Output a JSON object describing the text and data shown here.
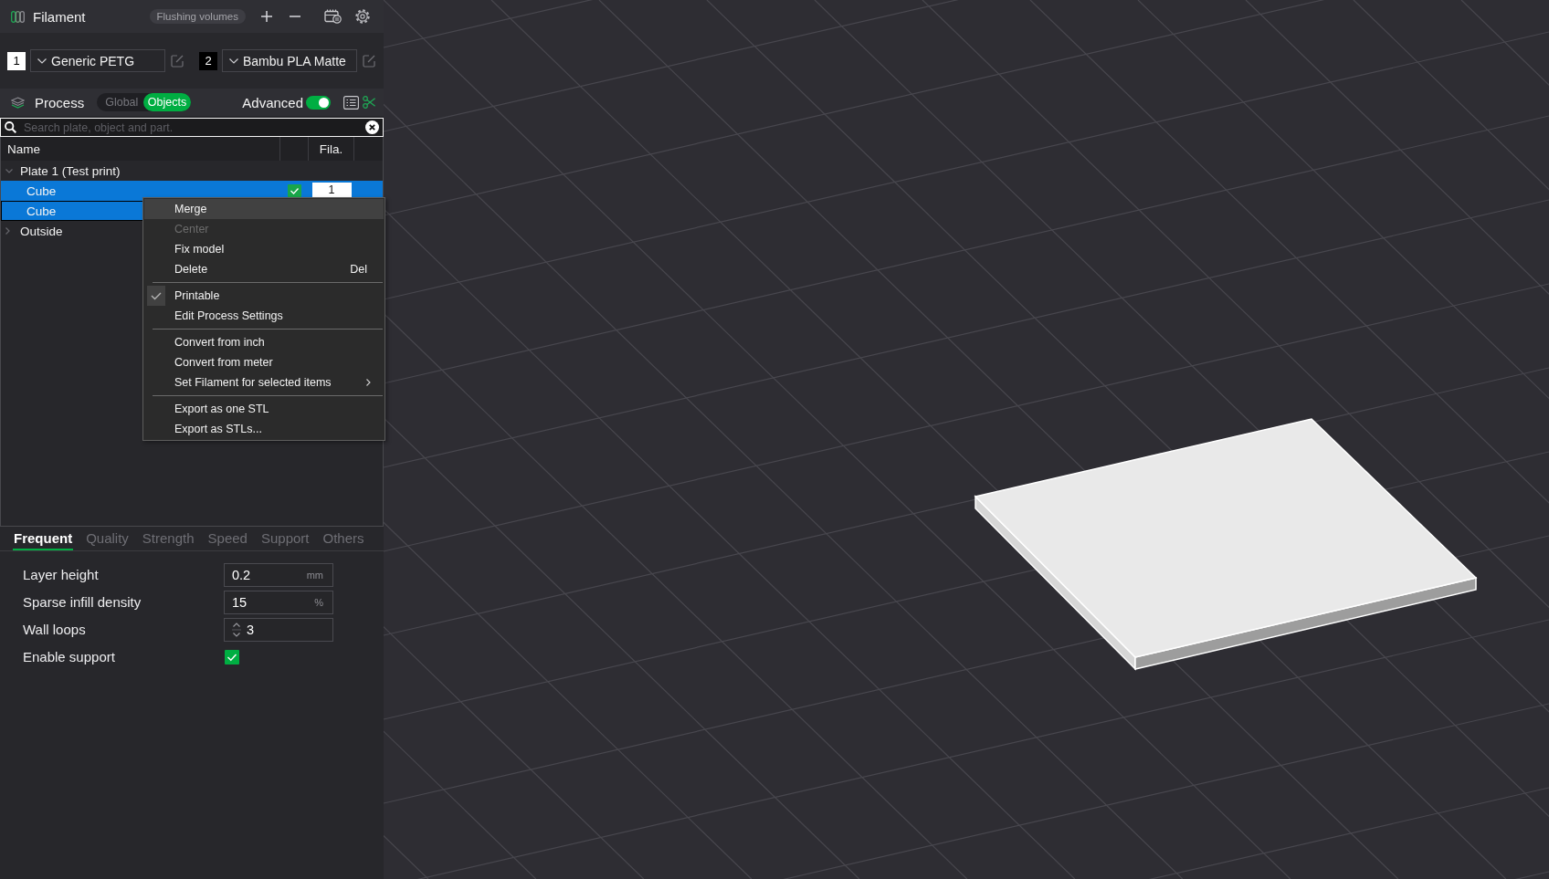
{
  "filament": {
    "title": "Filament",
    "flushing_button": "Flushing volumes",
    "slots": [
      {
        "number": "1",
        "color": "#ffffff",
        "material": "Generic PETG"
      },
      {
        "number": "2",
        "color": "#000000",
        "material": "Bambu PLA Matte"
      }
    ]
  },
  "process": {
    "title": "Process",
    "modes": [
      {
        "label": "Global",
        "selected": false
      },
      {
        "label": "Objects",
        "selected": true
      }
    ],
    "advanced": {
      "label": "Advanced",
      "on": true
    }
  },
  "search": {
    "placeholder": "Search plate, object and part."
  },
  "object_list": {
    "columns": {
      "name": "Name",
      "filament": "Fila."
    },
    "rows": [
      {
        "label": "Plate 1 (Test print)",
        "selected": false,
        "focused": false,
        "expanded": true,
        "children": [
          {
            "label": "Cube",
            "selected": true,
            "focused": false,
            "printable": true,
            "filament": "1"
          },
          {
            "label": "Cube",
            "selected": true,
            "focused": true
          }
        ]
      },
      {
        "label": "Outside",
        "selected": false,
        "focused": false,
        "expanded": false
      }
    ]
  },
  "context_menu": [
    {
      "kind": "item",
      "label": "Merge",
      "highlighted": true,
      "disabled": false,
      "checked": false,
      "submenu": false
    },
    {
      "kind": "item",
      "label": "Center",
      "highlighted": false,
      "disabled": true,
      "checked": false,
      "submenu": false
    },
    {
      "kind": "item",
      "label": "Fix model",
      "highlighted": false,
      "disabled": false,
      "checked": false,
      "submenu": false
    },
    {
      "kind": "item",
      "label": "Delete",
      "shortcut": "Del",
      "highlighted": false,
      "disabled": false,
      "checked": false,
      "submenu": false
    },
    {
      "kind": "separator"
    },
    {
      "kind": "item",
      "label": "Printable",
      "highlighted": false,
      "disabled": false,
      "checked": true,
      "submenu": false
    },
    {
      "kind": "item",
      "label": "Edit Process Settings",
      "highlighted": false,
      "disabled": false,
      "checked": false,
      "submenu": false
    },
    {
      "kind": "separator"
    },
    {
      "kind": "item",
      "label": "Convert from inch",
      "highlighted": false,
      "disabled": false,
      "checked": false,
      "submenu": false
    },
    {
      "kind": "item",
      "label": "Convert from meter",
      "highlighted": false,
      "disabled": false,
      "checked": false,
      "submenu": false
    },
    {
      "kind": "item",
      "label": "Set Filament for selected items",
      "highlighted": false,
      "disabled": false,
      "checked": false,
      "submenu": true
    },
    {
      "kind": "separator"
    },
    {
      "kind": "item",
      "label": "Export as one STL",
      "highlighted": false,
      "disabled": false,
      "checked": false,
      "submenu": false
    },
    {
      "kind": "item",
      "label": "Export as STLs...",
      "highlighted": false,
      "disabled": false,
      "checked": false,
      "submenu": false
    }
  ],
  "settings_tabs": [
    {
      "label": "Frequent",
      "selected": true
    },
    {
      "label": "Quality",
      "selected": false
    },
    {
      "label": "Strength",
      "selected": false
    },
    {
      "label": "Speed",
      "selected": false
    },
    {
      "label": "Support",
      "selected": false
    },
    {
      "label": "Others",
      "selected": false
    }
  ],
  "settings": [
    {
      "kind": "number",
      "label": "Layer height",
      "value": "0.2",
      "unit": "mm"
    },
    {
      "kind": "number",
      "label": "Sparse infill density",
      "value": "15",
      "unit": "%"
    },
    {
      "kind": "spin",
      "label": "Wall loops",
      "value": "3"
    },
    {
      "kind": "checkbox",
      "label": "Enable support",
      "checked": true
    }
  ]
}
